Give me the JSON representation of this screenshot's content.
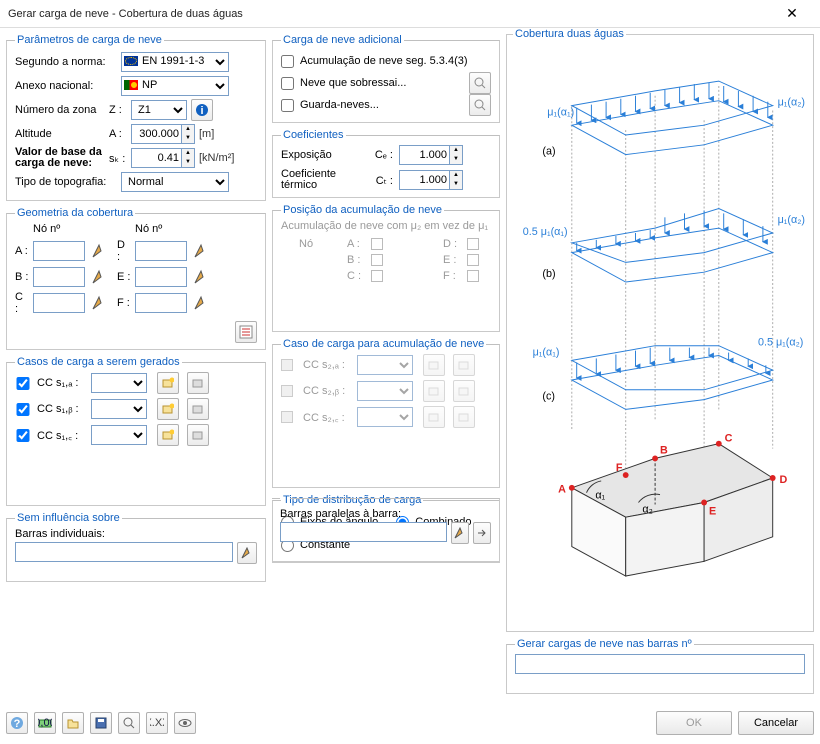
{
  "window": {
    "title": "Gerar carga de neve - Cobertura de duas águas"
  },
  "groups": {
    "params": "Parâmetros de carga de neve",
    "extra": "Carga de neve adicional",
    "coef": "Coeficientes",
    "geom": "Geometria da cobertura",
    "accum": "Posição da acumulação de neve",
    "cases": "Casos de carga a serem gerados",
    "casesAccum": "Caso de carga para acumulação de neve",
    "dist": "Tipo de distribução de carga",
    "sem": "Sem influência sobre",
    "gerar": "Gerar cargas de neve nas barras nº",
    "diagram": "Cobertura duas águas"
  },
  "params": {
    "normLabel": "Segundo a norma:",
    "normValue": "EN 1991-1-3",
    "annexLabel": "Anexo nacional:",
    "annexValue": "NP",
    "zoneLabel": "Número da zona",
    "zoneSym": "Z :",
    "zoneValue": "Z1",
    "altLabel": "Altitude",
    "altSym": "A :",
    "altValue": "300.000",
    "altUnit": "[m]",
    "baseLabel1": "Valor de base da",
    "baseLabel2": "carga de neve:",
    "baseSym": "sₖ :",
    "baseValue": "0.41",
    "baseUnit": "[kN/m²]",
    "topoLabel": "Tipo de topografia:",
    "topoValue": "Normal"
  },
  "extra": {
    "c1": "Acumulação de neve seg. 5.3.4(3)",
    "c2": "Neve que sobressai...",
    "c3": "Guarda-neves..."
  },
  "coef": {
    "expLabel": "Exposição",
    "expSym": "Cₑ :",
    "expValue": "1.000",
    "thermLabel1": "Coeficiente",
    "thermLabel2": "térmico",
    "thermSym": "Cₜ :",
    "thermValue": "1.000"
  },
  "geom": {
    "hdr1": "Nó nº",
    "hdr2": "Nó nº",
    "A": "A :",
    "B": "B :",
    "C": "C :",
    "D": "D :",
    "E": "E :",
    "F": "F :"
  },
  "accum": {
    "desc": "Acumulação de neve com μ₂ em vez de μ₁",
    "no": "Nó",
    "A": "A :",
    "B": "B :",
    "C": "C :",
    "D": "D :",
    "E": "E :",
    "F": "F :"
  },
  "cases": [
    {
      "label": "CC s₁,ₐ :"
    },
    {
      "label": "CC s₁,ᵦ :"
    },
    {
      "label": "CC s₁,꜀ :"
    }
  ],
  "casesAccum": [
    {
      "label": "CC s₂,ₐ :"
    },
    {
      "label": "CC s₂,ᵦ :"
    },
    {
      "label": "CC s₂,꜀ :"
    }
  ],
  "dist": {
    "o1": "Eixos do ângulo",
    "o2": "Combinado",
    "o3": "Constante"
  },
  "sem": {
    "l1": "Barras individuais:",
    "l2": "Barras paralelas à barra:"
  },
  "footer": {
    "ok": "OK",
    "cancel": "Cancelar"
  },
  "diagram": {
    "mu1a1": "μ₁(α₁)",
    "mu1a2": "μ₁(α₂)",
    "half_mu1a1": "0.5 μ₁(α₁)",
    "half_mu1a2": "0.5 μ₁(α₂)",
    "a": "(a)",
    "b": "(b)",
    "c": "(c)",
    "A": "A",
    "B": "B",
    "C": "C",
    "D": "D",
    "E": "E",
    "F": "F",
    "alpha1": "α₁",
    "alpha2": "α₂"
  }
}
